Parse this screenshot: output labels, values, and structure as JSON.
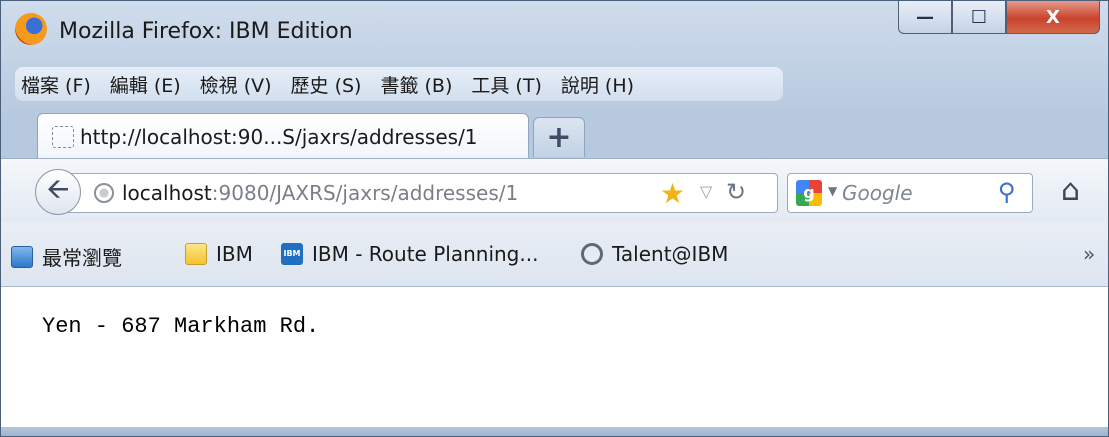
{
  "window": {
    "title": "Mozilla Firefox: IBM Edition",
    "app_icon": "firefox-icon",
    "controls": {
      "minimize_label": "—",
      "maximize_label": "☐",
      "close_label": "X"
    }
  },
  "menubar": {
    "items": [
      {
        "label": "檔案 (F)"
      },
      {
        "label": "編輯 (E)"
      },
      {
        "label": "檢視 (V)"
      },
      {
        "label": "歷史 (S)"
      },
      {
        "label": "書籤 (B)"
      },
      {
        "label": "工具 (T)"
      },
      {
        "label": "說明 (H)"
      }
    ]
  },
  "tabs": {
    "active": {
      "title": "http://localhost:90...S/jaxrs/addresses/1"
    },
    "new_tab_label": "+"
  },
  "navbar": {
    "back_icon": "back-arrow-icon",
    "url_host": "localhost",
    "url_rest": ":9080/JAXRS/jaxrs/addresses/1",
    "star_icon": "bookmark-star-icon",
    "reload_icon": "reload-icon",
    "search": {
      "engine": "Google",
      "placeholder": "Google"
    },
    "home_icon": "home-icon"
  },
  "bookmarks": {
    "items": [
      {
        "label": "最常瀏覽",
        "icon": "most-visited-icon"
      },
      {
        "label": "IBM",
        "icon": "folder-icon"
      },
      {
        "label": "IBM - Route Planning...",
        "icon": "ibm-logo-icon"
      },
      {
        "label": "Talent@IBM",
        "icon": "talent-icon"
      }
    ],
    "overflow_label": "»"
  },
  "content": {
    "text": "Yen - 687 Markham Rd."
  },
  "colors": {
    "chrome": "#b7c9df",
    "close_button": "#c9432c",
    "star": "#f1b21a"
  }
}
